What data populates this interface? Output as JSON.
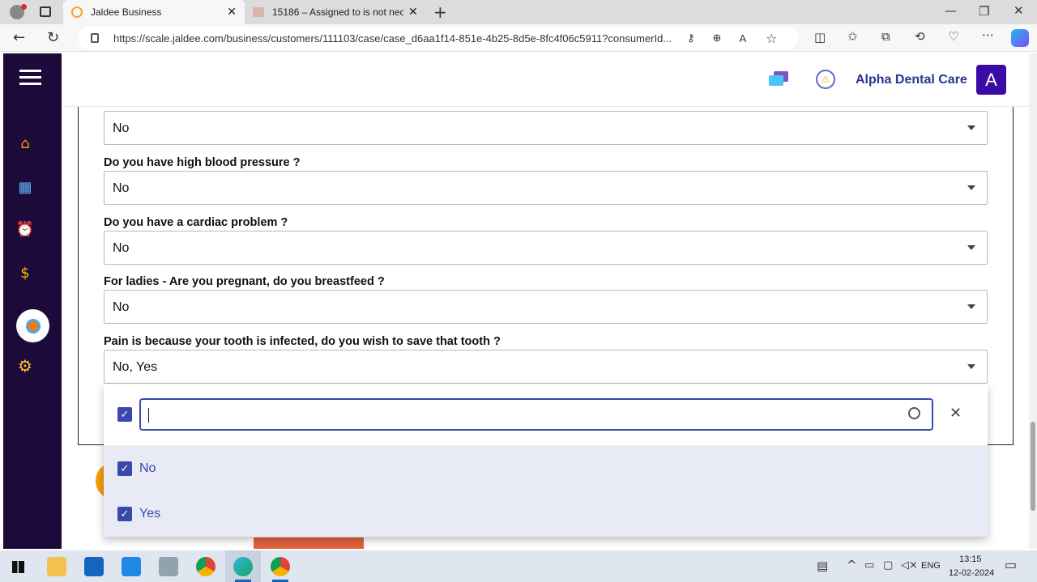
{
  "browser": {
    "tabs": [
      {
        "title": "Jaldee Business",
        "active": true
      },
      {
        "title": "15186 – Assigned to is not neces",
        "active": false
      }
    ],
    "url": "https://scale.jaldee.com/business/customers/111103/case/case_d6aa1f14-851e-4b25-8d5e-8fc4f06c5911?consumerId..."
  },
  "header": {
    "business_name": "Alpha Dental Care",
    "avatar_letter": "A"
  },
  "questions": [
    {
      "label": "",
      "value": "No"
    },
    {
      "label": "Do you have high blood pressure ?",
      "value": "No"
    },
    {
      "label": "Do you have a cardiac problem ?",
      "value": "No"
    },
    {
      "label": "For ladies - Are you pregnant, do you breastfeed ?",
      "value": "No"
    },
    {
      "label": "Pain is because your tooth is infected, do you wish to save that tooth ?",
      "value": "No, Yes"
    }
  ],
  "dropdown": {
    "search_value": "",
    "options": [
      {
        "label": "No",
        "checked": true
      },
      {
        "label": "Yes",
        "checked": true
      }
    ]
  },
  "taskbar": {
    "time": "13:15",
    "date": "12-02-2024",
    "language": "ENG"
  },
  "colors": {
    "sidebar": "#1b0a3a",
    "accent": "#3949ab",
    "avatar_bg": "#3a0ca3"
  }
}
